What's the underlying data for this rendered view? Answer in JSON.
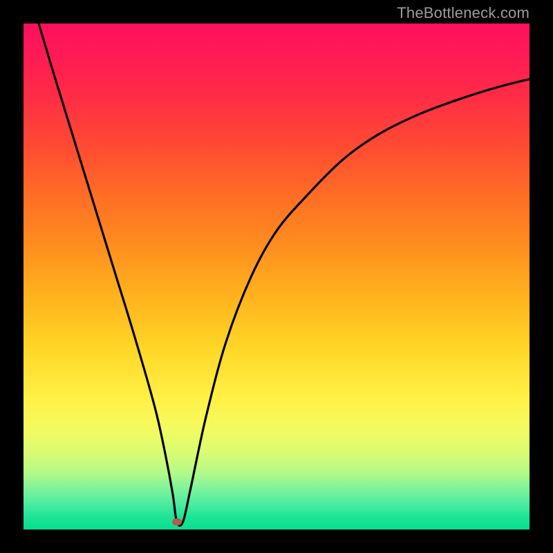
{
  "watermark": "TheBottleneck.com",
  "colors": {
    "curve": "#000000",
    "marker": "#b65a4f",
    "frame": "#000000"
  },
  "chart_data": {
    "type": "line",
    "title": "",
    "xlabel": "",
    "ylabel": "",
    "xlim": [
      0,
      100
    ],
    "ylim": [
      0,
      100
    ],
    "grid": false,
    "legend": false,
    "notes": "Bottleneck-style V curve. No axes or tick labels are shown; values are estimated from pixel positions relative to the plot area (0–100 normalized).",
    "series": [
      {
        "name": "curve",
        "x": [
          3,
          6,
          10,
          14,
          18,
          22,
          26,
          28,
          29.5,
          30.3,
          31.5,
          33,
          36,
          40,
          45,
          50,
          56,
          63,
          70,
          78,
          86,
          94,
          100
        ],
        "y": [
          100,
          90,
          77,
          64,
          51,
          38,
          24,
          15,
          7,
          1.5,
          1.5,
          8,
          22,
          37,
          50,
          59,
          66,
          73,
          78,
          82,
          85,
          87.5,
          89
        ]
      }
    ],
    "marker": {
      "x": 30.3,
      "y": 1.5
    }
  }
}
